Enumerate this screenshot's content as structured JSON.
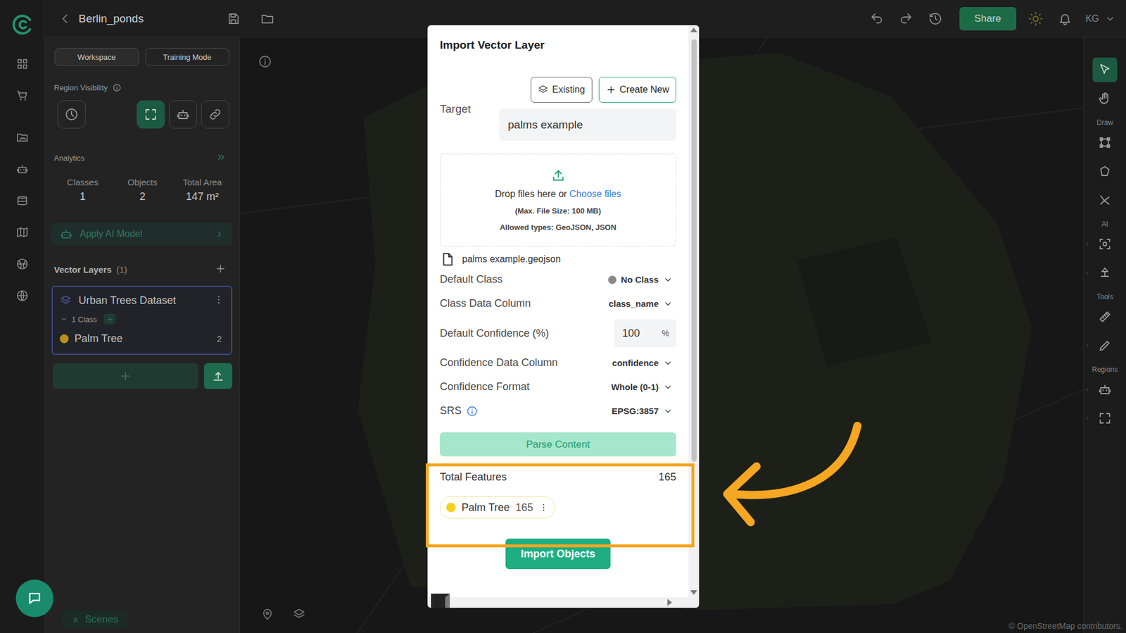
{
  "topbar": {
    "title": "Berlin_ponds",
    "share": "Share",
    "avatar": "KG"
  },
  "rail": [
    {
      "kind": "dashboard"
    },
    {
      "kind": "cart"
    },
    {
      "kind": "folder-image"
    },
    {
      "kind": "robot"
    },
    {
      "kind": "database"
    },
    {
      "kind": "map"
    },
    {
      "kind": "ball"
    },
    {
      "kind": "globe"
    }
  ],
  "left_panel": {
    "modes": [
      {
        "label": "Workspace",
        "selected": true
      },
      {
        "label": "Training Mode",
        "selected": false
      }
    ],
    "region_visibility": {
      "label": "Region Visibility",
      "buttons": [
        {
          "kind": "clock",
          "selected": false
        },
        {
          "kind": "frame",
          "selected": true
        },
        {
          "kind": "robot",
          "selected": false
        },
        {
          "kind": "link",
          "selected": false
        }
      ]
    },
    "analytics": {
      "title": "Analytics",
      "stats": [
        {
          "label": "Classes",
          "value": "1"
        },
        {
          "label": "Objects",
          "value": "2"
        },
        {
          "label": "Total Area",
          "value": "147 m²"
        }
      ]
    },
    "apply_ai": "Apply AI Model",
    "vector_layers": {
      "title": "Vector Layers",
      "count": "(1)",
      "layers": [
        {
          "name": "Urban Trees Dataset",
          "classes_label": "1 Class",
          "expanded": true,
          "classes": [
            {
              "name": "Palm Tree",
              "count": "2",
              "color": "#b8921c"
            }
          ]
        }
      ]
    },
    "scenes": "Scenes"
  },
  "map": {
    "attribution": "© OpenStreetMap contributors."
  },
  "toolbar": {
    "top": [
      {
        "kind": "cursor",
        "selected": true
      },
      {
        "kind": "hand",
        "selected": false
      }
    ],
    "groups": [
      {
        "label": "Draw",
        "tools": [
          {
            "kind": "rect",
            "flyout": false
          },
          {
            "kind": "polygon",
            "flyout": false
          },
          {
            "kind": "nodes",
            "flyout": false
          }
        ]
      },
      {
        "label": "AI",
        "tools": [
          {
            "kind": "ai-eye",
            "flyout": true
          },
          {
            "kind": "ai-tree",
            "flyout": true
          }
        ]
      },
      {
        "label": "Tools",
        "tools": [
          {
            "kind": "ruler",
            "flyout": false
          },
          {
            "kind": "pen",
            "flyout": true
          }
        ]
      },
      {
        "label": "Regions",
        "tools": [
          {
            "kind": "robot",
            "flyout": true
          },
          {
            "kind": "frame",
            "flyout": true
          }
        ]
      }
    ]
  },
  "dialog": {
    "title": "Import Vector Layer",
    "target": {
      "label": "Target",
      "buttons": [
        {
          "label": "Existing",
          "kind": "layers",
          "primary": false
        },
        {
          "label": "Create New",
          "kind": "plus",
          "primary": true
        }
      ],
      "value": "palms example"
    },
    "dropzone": {
      "text": "Drop files here",
      "or": "or",
      "link": "Choose files",
      "limit": "(Max. File Size: 100 MB)",
      "types": "Allowed types: GeoJSON, JSON"
    },
    "file": "palms example.geojson",
    "fields": [
      {
        "label": "Default Class",
        "value": "No Class",
        "kind": "select",
        "color": "#8a8a8a",
        "info": false
      },
      {
        "label": "Class Data Column",
        "value": "class_name",
        "kind": "select",
        "info": false
      },
      {
        "label": "Default Confidence (%)",
        "value": "100",
        "unit": "%",
        "kind": "input",
        "info": false
      },
      {
        "label": "Confidence Data Column",
        "value": "confidence",
        "kind": "select",
        "info": false
      },
      {
        "label": "Confidence Format",
        "value": "Whole (0-1)",
        "kind": "select",
        "info": false
      },
      {
        "label": "SRS",
        "value": "EPSG:3857",
        "kind": "select",
        "info": true
      }
    ],
    "parse": "Parse Content",
    "summary": {
      "label": "Total Features",
      "value": "165",
      "classes": [
        {
          "name": "Palm Tree",
          "count": "165",
          "color": "#f6d11c"
        }
      ]
    },
    "import": "Import Objects"
  }
}
